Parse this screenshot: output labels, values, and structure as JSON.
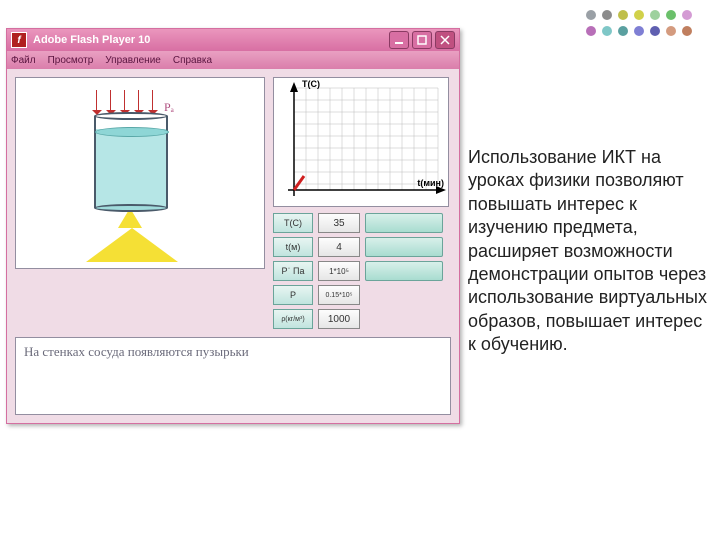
{
  "window": {
    "title": "Adobe Flash Player 10",
    "menus": [
      "Файл",
      "Просмотр",
      "Управление",
      "Справка"
    ]
  },
  "params": {
    "rows": [
      {
        "label": "T(C)",
        "value": "35"
      },
      {
        "label": "t(м)",
        "value": "4"
      },
      {
        "label": "Pˈ Па",
        "value": "1*10⁵"
      },
      {
        "label": "P",
        "value": "0.15*10⁵"
      },
      {
        "label": "ρ(кг/м³)",
        "value": "1000"
      }
    ]
  },
  "chart": {
    "ylabel": "T(C)",
    "xlabel": "t(мин)"
  },
  "viz": {
    "pressure_label": "Pₐ"
  },
  "status": {
    "text": "На стенках сосуда появляются пузырьки"
  },
  "side_text": "Использование ИКТ на уроках физики позволяют повышать интерес к изучению предмета, расширяет возможности демонстрации опытов через использование виртуальных образов, повышает интерес к обучению.",
  "decor_colors": [
    "#9aa0a6",
    "#8c8c8c",
    "#bfbf4a",
    "#d1d14a",
    "#9ed19e",
    "#6bc06b",
    "#d49bd4",
    "#b86fb8",
    "#7fc7c7",
    "#5aa0a0",
    "#7f7fd4",
    "#5f5fb0",
    "#d49b7f",
    "#c07f5f"
  ]
}
